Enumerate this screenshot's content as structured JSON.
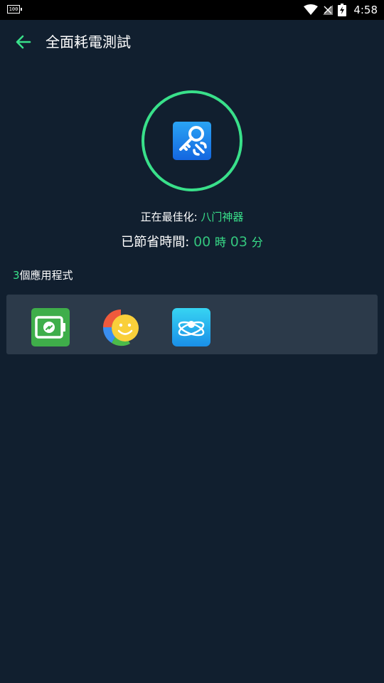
{
  "status_bar": {
    "battery_left_label": "100",
    "time": "4:58",
    "icons": [
      "wifi-icon",
      "signal-off-icon",
      "battery-charging-icon"
    ]
  },
  "header": {
    "title": "全面耗電測試",
    "back_icon": "arrow-left-icon"
  },
  "colors": {
    "background": "#111f2f",
    "accent": "#39e08a",
    "panel": "#2c3a4a"
  },
  "optimization": {
    "label": "正在最佳化: ",
    "app_name": "八门神器"
  },
  "saved_time": {
    "label": "已節省時間: ",
    "hours": "00",
    "hours_unit": "時",
    "minutes": "03",
    "minutes_unit": "分"
  },
  "apps": {
    "count": "3",
    "count_label": "個應用程式",
    "items": [
      {
        "icon": "battery-app-icon"
      },
      {
        "icon": "smiley-app-icon"
      },
      {
        "icon": "atom-app-icon"
      }
    ]
  }
}
